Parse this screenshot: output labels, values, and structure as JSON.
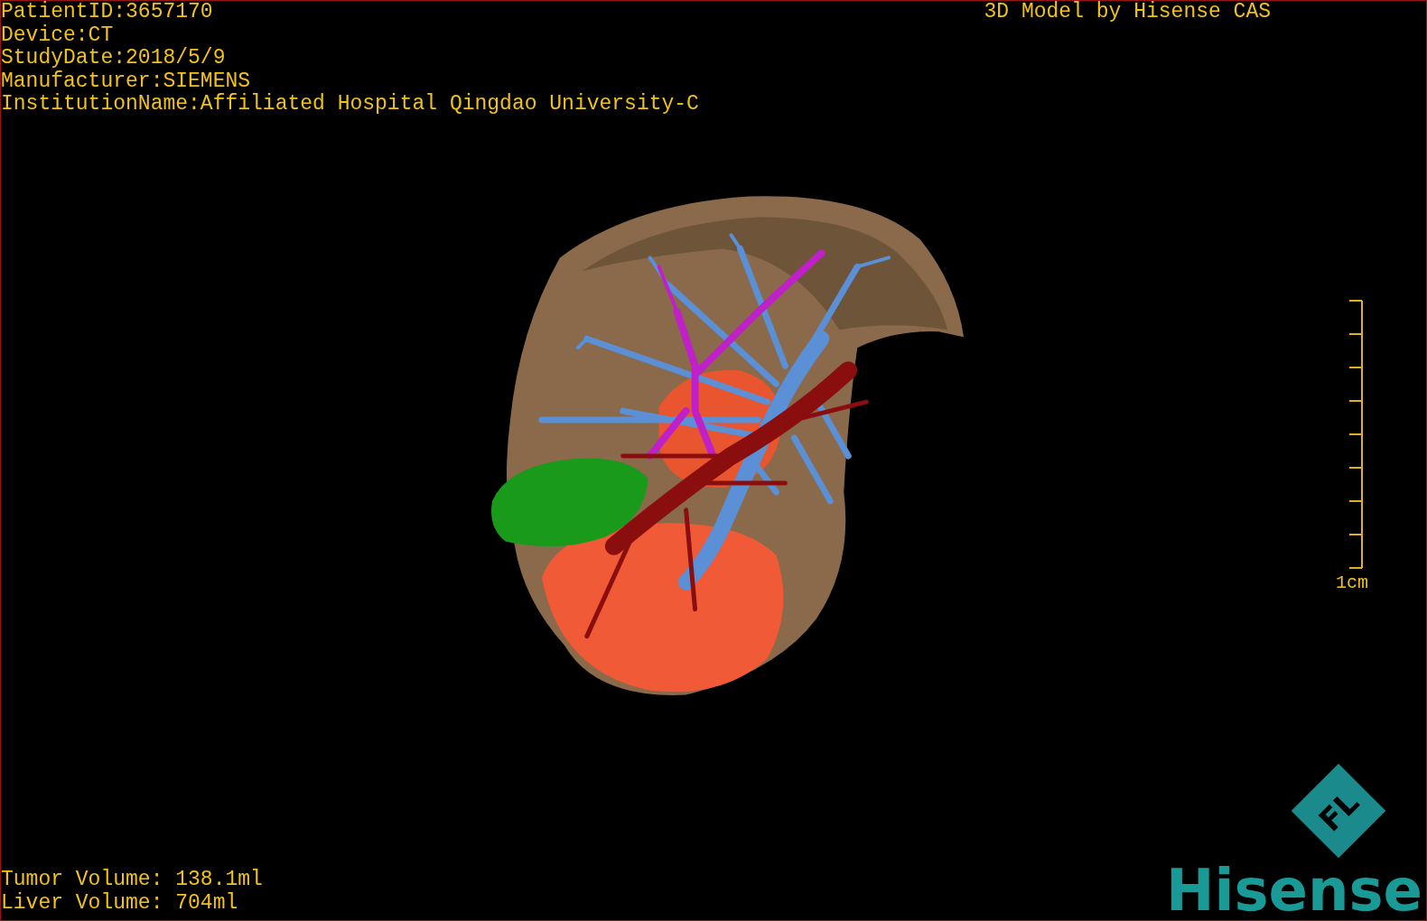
{
  "header": {
    "info_lines": [
      "PatientID:3657170",
      "Device:CT",
      "StudyDate:2018/5/9",
      "Manufacturer:SIEMENS",
      "InstitutionName:Affiliated Hospital Qingdao University-C"
    ],
    "title": "3D Model by Hisense CAS"
  },
  "scale_bar": {
    "label": "1cm"
  },
  "volumes": [
    "Tumor Volume: 138.1ml",
    "Liver Volume: 704ml"
  ],
  "logo": {
    "mark_text": "FL",
    "wordmark": "Hisense"
  }
}
